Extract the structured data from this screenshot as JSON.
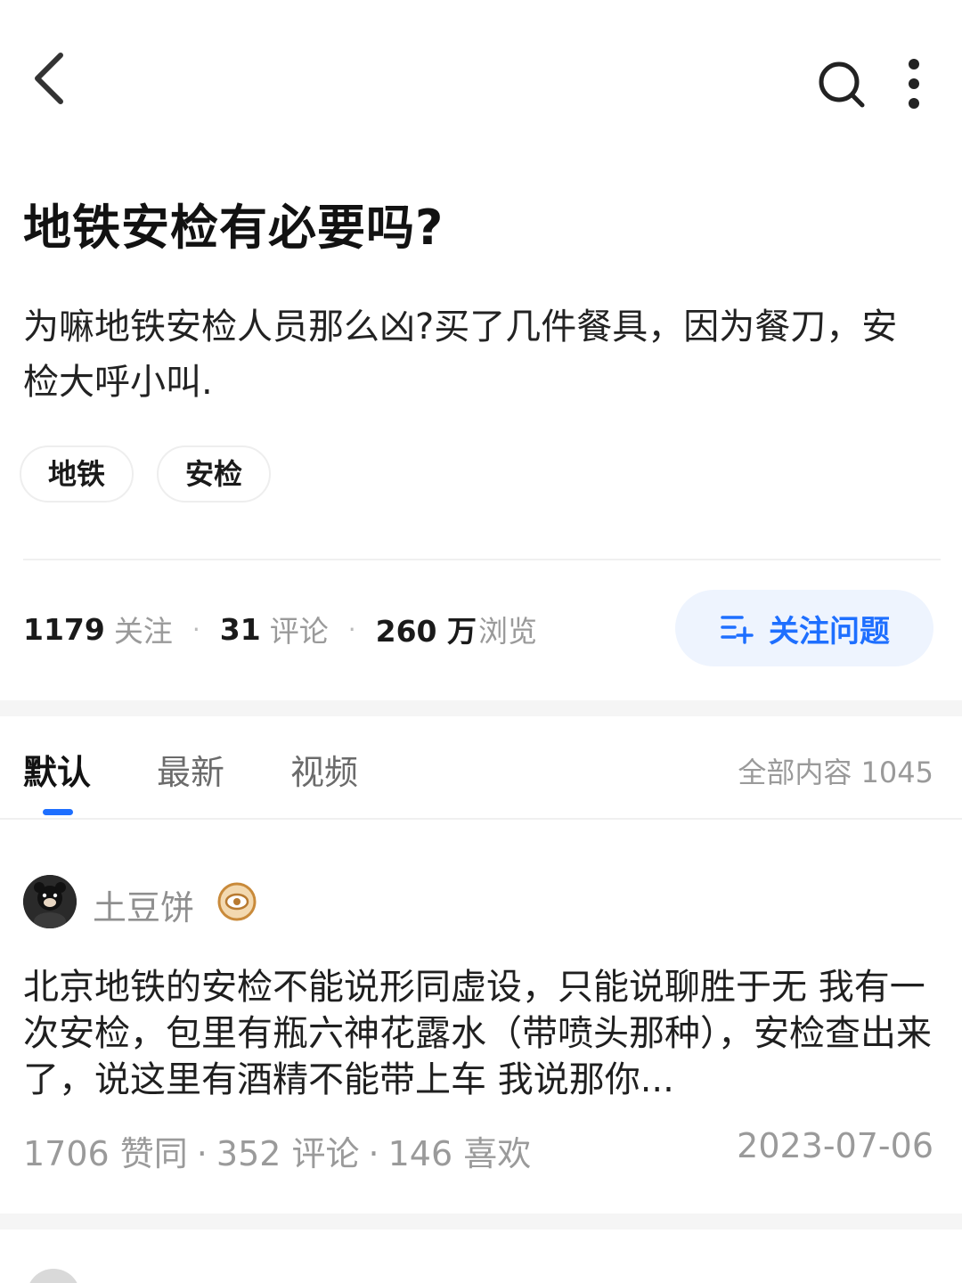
{
  "header": {
    "back_icon": "chevron-left-icon",
    "search_icon": "search-icon",
    "more_icon": "more-vertical-icon"
  },
  "question": {
    "title": "地铁安检有必要吗?",
    "description": "为嘛地铁安检人员那么凶?买了几件餐具，因为餐刀，安检大呼小叫.",
    "tags": [
      "地铁",
      "安检"
    ]
  },
  "stats": {
    "followers_num": "1179",
    "followers_label": "关注",
    "comments_num": "31",
    "comments_label": "评论",
    "views_num": "260 万",
    "views_label": "浏览",
    "separator": "·",
    "follow_button_label": "关注问题",
    "accent_color": "#1e6fff"
  },
  "tabs": {
    "items": [
      "默认",
      "最新",
      "视频"
    ],
    "active_index": 0,
    "total_label": "全部内容 1045"
  },
  "answer": {
    "author": "土豆饼",
    "text": "北京地铁的安检不能说形同虚设，只能说聊胜于无 我有一次安检，包里有瓶六神花露水（带喷头那种），安检查出来了，说这里有酒精不能带上车 我说那你...",
    "likes": "1706 赞同",
    "comments": "352 评论",
    "favorites": "146 喜欢",
    "separator": "·",
    "date": "2023-07-06"
  }
}
